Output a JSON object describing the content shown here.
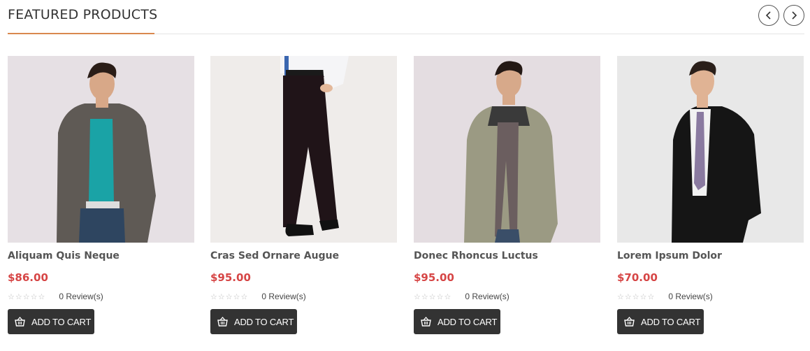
{
  "section": {
    "title": "FEATURED PRODUCTS"
  },
  "colors": {
    "accent_underline": "#d9884f",
    "price": "#d64545",
    "button_bg": "#333333"
  },
  "products": [
    {
      "name": "Aliquam Quis Neque",
      "price": "$86.00",
      "reviews": "0 Review(s)",
      "cart_label": "ADD TO CART"
    },
    {
      "name": "Cras Sed Ornare Augue",
      "price": "$95.00",
      "reviews": "0 Review(s)",
      "cart_label": "ADD TO CART"
    },
    {
      "name": "Donec Rhoncus Luctus",
      "price": "$95.00",
      "reviews": "0 Review(s)",
      "cart_label": "ADD TO CART"
    },
    {
      "name": "Lorem Ipsum Dolor",
      "price": "$70.00",
      "reviews": "0 Review(s)",
      "cart_label": "ADD TO CART"
    }
  ],
  "icons": {
    "prev": "chevron-left-icon",
    "next": "chevron-right-icon",
    "cart": "basket-icon",
    "rating": "star-outline-icon"
  }
}
